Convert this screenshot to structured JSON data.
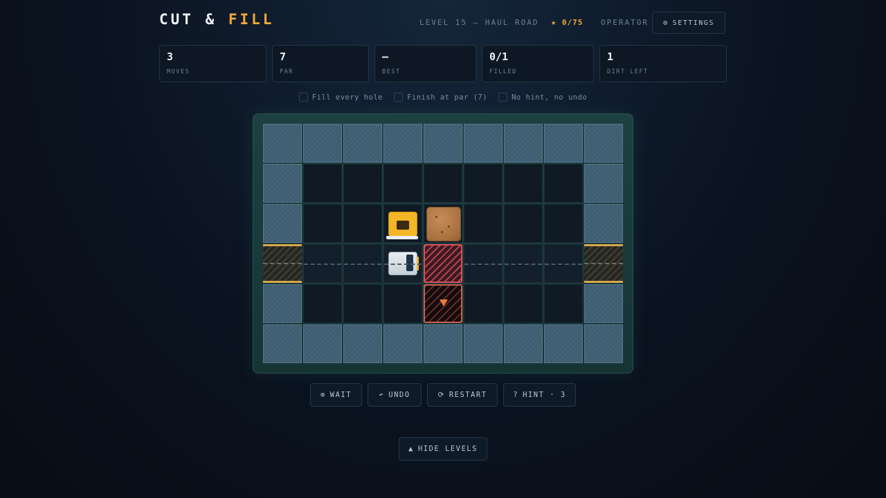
{
  "header": {
    "title_part1": "CUT & ",
    "title_part2": "FILL",
    "level_label": "LEVEL 15 — HAUL ROAD",
    "stars_icon": "★",
    "stars_value": "0/75",
    "operator_label": "OPERATOR",
    "settings_icon": "⚙",
    "settings_label": "SETTINGS"
  },
  "stats": [
    {
      "value": "3",
      "label": "MOVES"
    },
    {
      "value": "7",
      "label": "PAR"
    },
    {
      "value": "—",
      "label": "BEST"
    },
    {
      "value": "0/1",
      "label": "FILLED"
    },
    {
      "value": "1",
      "label": "DIRT LEFT"
    }
  ],
  "goals": [
    {
      "label": "Fill every hole",
      "checked": false
    },
    {
      "label": "Finish at par (7)",
      "checked": false
    },
    {
      "label": "No hint, no undo",
      "checked": false
    }
  ],
  "board": {
    "rows": 6,
    "cols": 9,
    "grid": [
      [
        "wall",
        "wall",
        "wall",
        "wall",
        "wall",
        "wall",
        "wall",
        "wall",
        "wall"
      ],
      [
        "wall",
        "floor",
        "floor",
        "floor",
        "floor",
        "floor",
        "floor",
        "floor",
        "wall"
      ],
      [
        "wall",
        "floor",
        "floor",
        "truck",
        "dirt",
        "floor",
        "floor",
        "floor",
        "wall"
      ],
      [
        "gate",
        "road",
        "road",
        "dozer",
        "hole",
        "road",
        "road",
        "road",
        "gate"
      ],
      [
        "wall",
        "floor",
        "floor",
        "floor",
        "cut",
        "floor",
        "floor",
        "floor",
        "wall"
      ],
      [
        "wall",
        "wall",
        "wall",
        "wall",
        "wall",
        "wall",
        "wall",
        "wall",
        "wall"
      ]
    ]
  },
  "controls": {
    "wait_icon": "⊚",
    "wait_label": "WAIT",
    "undo_icon": "↶",
    "undo_label": "UNDO",
    "restart_icon": "⟳",
    "restart_label": "RESTART",
    "hint_icon": "?",
    "hint_label": "HINT · 3"
  },
  "levels_toggle": {
    "icon": "▲",
    "label": "HIDE LEVELS"
  },
  "colors": {
    "accent": "#f2a93b",
    "hole": "#d9505a",
    "background": "#0b1320"
  }
}
